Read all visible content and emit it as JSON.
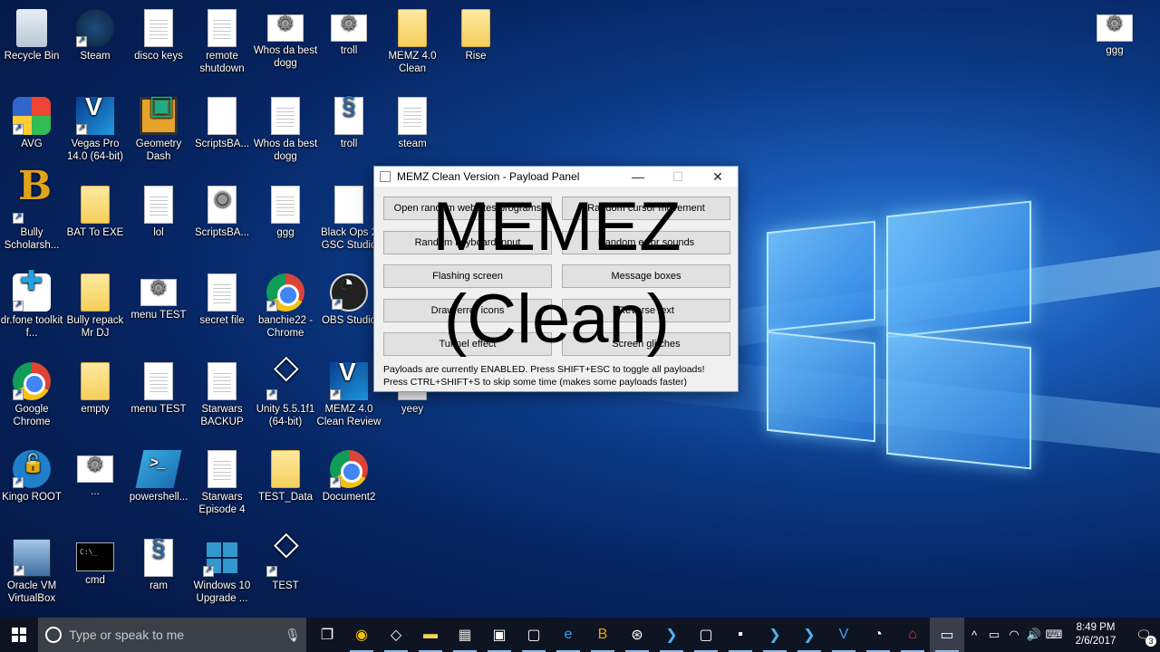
{
  "desktop": {
    "icons": [
      {
        "label": "Recycle Bin",
        "icon": "recycle-bin-icon"
      },
      {
        "label": "Steam",
        "icon": "steam-icon"
      },
      {
        "label": "disco keys",
        "icon": "document-icon"
      },
      {
        "label": "remote shutdown",
        "icon": "document-icon"
      },
      {
        "label": "Whos da best dogg",
        "icon": "settings-file-icon"
      },
      {
        "label": "troll",
        "icon": "settings-file-icon"
      },
      {
        "label": "MEMZ 4.0 Clean",
        "icon": "folder-icon"
      },
      {
        "label": "Rise",
        "icon": "folder-icon"
      },
      {
        "label": "ggg",
        "icon": "settings-file-icon"
      },
      {
        "label": "AVG",
        "icon": "avg-icon"
      },
      {
        "label": "Vegas Pro 14.0 (64-bit)",
        "icon": "vegas-pro-icon"
      },
      {
        "label": "Geometry Dash",
        "icon": "geometry-dash-icon"
      },
      {
        "label": "ScriptsBA...",
        "icon": "blank-file-icon"
      },
      {
        "label": "Whos da best dogg",
        "icon": "document-icon"
      },
      {
        "label": "troll",
        "icon": "script-icon"
      },
      {
        "label": "steam",
        "icon": "document-icon"
      },
      {
        "label": "Bully Scholarsh...",
        "icon": "bully-icon"
      },
      {
        "label": "BAT To EXE",
        "icon": "folder-icon"
      },
      {
        "label": "lol",
        "icon": "document-icon"
      },
      {
        "label": "ScriptsBA...",
        "icon": "disc-image-icon"
      },
      {
        "label": "ggg",
        "icon": "document-icon"
      },
      {
        "label": "Black Ops 2 GSC Studio",
        "icon": "blank-file-icon"
      },
      {
        "label": "dr.fone toolkit f...",
        "icon": "drfone-icon"
      },
      {
        "label": "Bully repack Mr DJ",
        "icon": "folder-icon"
      },
      {
        "label": "menu TEST",
        "icon": "settings-file-icon"
      },
      {
        "label": "secret file",
        "icon": "document-icon"
      },
      {
        "label": "banchie22 - Chrome",
        "icon": "chrome-icon"
      },
      {
        "label": "OBS Studio",
        "icon": "obs-icon"
      },
      {
        "label": "Google Chrome",
        "icon": "chrome-icon"
      },
      {
        "label": "empty",
        "icon": "folder-icon"
      },
      {
        "label": "menu TEST",
        "icon": "document-icon"
      },
      {
        "label": "Starwars BACKUP",
        "icon": "document-icon"
      },
      {
        "label": "Unity 5.5.1f1 (64-bit)",
        "icon": "unity-icon"
      },
      {
        "label": "MEMZ 4.0 Clean Review",
        "icon": "vegas-pro-icon"
      },
      {
        "label": "yeey",
        "icon": "blank-file-icon"
      },
      {
        "label": "Kingo ROOT",
        "icon": "kingo-root-icon"
      },
      {
        "label": "...",
        "icon": "settings-file-icon"
      },
      {
        "label": "powershell...",
        "icon": "powershell-icon"
      },
      {
        "label": "Starwars Episode 4",
        "icon": "document-icon"
      },
      {
        "label": "TEST_Data",
        "icon": "folder-icon"
      },
      {
        "label": "Document2",
        "icon": "chrome-icon"
      },
      {
        "label": "Oracle VM VirtualBox",
        "icon": "virtualbox-icon"
      },
      {
        "label": "cmd",
        "icon": "cmd-icon"
      },
      {
        "label": "ram",
        "icon": "script-icon"
      },
      {
        "label": "Windows 10 Upgrade ...",
        "icon": "windows10-icon"
      },
      {
        "label": "TEST",
        "icon": "unity-icon"
      }
    ]
  },
  "window": {
    "title": "MEMZ Clean Version - Payload Panel",
    "minimize": "—",
    "maximize": "☐",
    "close": "✕",
    "buttons": [
      "Open random websites/programs",
      "Random cursor movement",
      "Random keyboard input",
      "Random error sounds",
      "Flashing screen",
      "Message boxes",
      "Draw error icons",
      "Reverse text",
      "Tunnel effect",
      "Screen glitches"
    ],
    "status_line1": "Payloads are currently ENABLED. Press SHIFT+ESC to toggle all payloads!",
    "status_line2": "Press CTRL+SHIFT+S to skip some time (makes some payloads faster)"
  },
  "overlay": {
    "line1": "MEMEZ",
    "line2": "(Clean)"
  },
  "taskbar": {
    "search_placeholder": "Type or speak to me",
    "apps": [
      "task-view-icon",
      "chrome-icon",
      "unity-icon",
      "file-explorer-icon",
      "store-icon",
      "remote-desktop-icon",
      "app-icon",
      "edge-icon",
      "bully-icon",
      "steam-icon",
      "powershell-icon",
      "app-icon",
      "cmd-icon",
      "powershell-icon",
      "powershell-icon",
      "vegas-pro-icon",
      "obs-icon",
      "acrobat-icon",
      "window-icon"
    ],
    "time": "8:49 PM",
    "date": "2/6/2017",
    "notification_count": "3"
  }
}
